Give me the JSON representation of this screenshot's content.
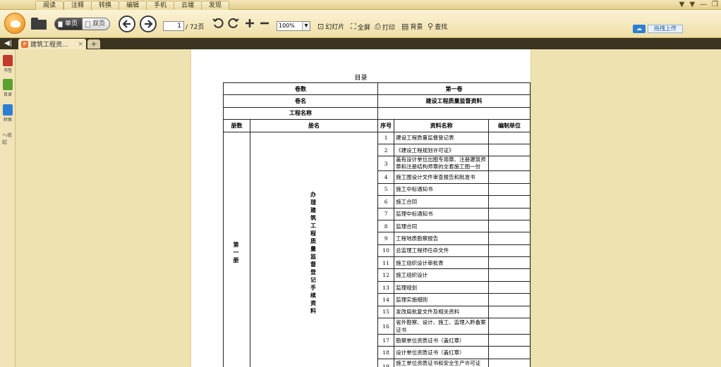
{
  "menu": {
    "tabs": [
      "阅读",
      "注释",
      "转换",
      "编辑",
      "手机",
      "云端",
      "发现"
    ]
  },
  "toolbar": {
    "single_page_label": "单页",
    "double_page_label": "双页",
    "page_current": "1",
    "page_total": "/ 72页",
    "zoom_value": "100%",
    "slideshow_label": "幻灯片",
    "fullscreen_label": "全屏",
    "print_label": "打印",
    "background_label": "背景",
    "search_label": "查找",
    "upload_label": "拖拽上传"
  },
  "tabs": {
    "doc_title": "建筑工程资...",
    "close_symbol": "×",
    "new_tab_symbol": "+"
  },
  "sidebar": {
    "items": [
      {
        "label": "书签",
        "color": "#c0392b"
      },
      {
        "label": "目录",
        "color": "#5aa02c"
      },
      {
        "label": "转换",
        "color": "#2d7fd2"
      }
    ],
    "collapse_label": "へ收起"
  },
  "document": {
    "title": "目录",
    "labels": {
      "volume_count": "卷数",
      "volume_name": "卷名",
      "project_name": "工程名称",
      "book_count": "册数",
      "book_name": "册名",
      "seq": "序号",
      "material_name": "资料名称",
      "compile_unit": "编制单位"
    },
    "volume_count_value": "第一卷",
    "volume_name_value": "建设工程质量监督资料",
    "book_count_value": "第一册",
    "book_name_value": "办理建筑工程质量监督登记手续资料",
    "rows": [
      {
        "seq": "1",
        "name": "建设工程质量监督登记表"
      },
      {
        "seq": "2",
        "name": "《建设工程规划许可证》"
      },
      {
        "seq": "3",
        "name": "盖有设计单位出图专用章、注册建筑师章和注册结构师章的全套施工图一份"
      },
      {
        "seq": "4",
        "name": "施工图设计文件审查报告和批准书"
      },
      {
        "seq": "5",
        "name": "施工中标通知书"
      },
      {
        "seq": "6",
        "name": "施工合同"
      },
      {
        "seq": "7",
        "name": "监理中标通知书"
      },
      {
        "seq": "8",
        "name": "监理合同"
      },
      {
        "seq": "9",
        "name": "工程地质勘察报告"
      },
      {
        "seq": "10",
        "name": "总监理工程师任命文件"
      },
      {
        "seq": "11",
        "name": "施工组织设计审批表"
      },
      {
        "seq": "12",
        "name": "施工组织设计"
      },
      {
        "seq": "13",
        "name": "监理规划"
      },
      {
        "seq": "14",
        "name": "监理实施细则"
      },
      {
        "seq": "15",
        "name": "发改局批复文件及相关资料"
      },
      {
        "seq": "16",
        "name": "省外勘察、设计、施工、监理入黔备案证书"
      },
      {
        "seq": "17",
        "name": "勘察单位资质证书（盖红章）"
      },
      {
        "seq": "18",
        "name": "设计单位资质证书（盖红章）"
      },
      {
        "seq": "19",
        "name": "施工单位资质证书和安全生产许可证（盖红"
      }
    ]
  }
}
